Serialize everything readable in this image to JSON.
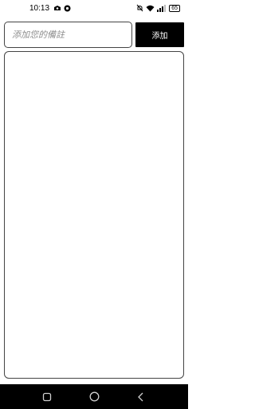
{
  "status_bar": {
    "time": "10:13",
    "battery": "65",
    "left_icons": [
      "notification-icon",
      "circle-app-icon"
    ],
    "right_icons": [
      "mute-icon",
      "wifi-icon",
      "signal-icon",
      "battery-icon"
    ]
  },
  "note_input": {
    "placeholder": "添加您的備註",
    "value": ""
  },
  "add_button": {
    "label": "添加"
  },
  "notes": [],
  "nav_bar": {
    "icons": [
      "recent-apps-icon",
      "home-icon",
      "back-icon"
    ]
  },
  "colors": {
    "button_background": "#000000",
    "button_text": "#ffffff",
    "border": "#444444",
    "placeholder": "#8c8c8c",
    "nav_background": "#000000"
  }
}
